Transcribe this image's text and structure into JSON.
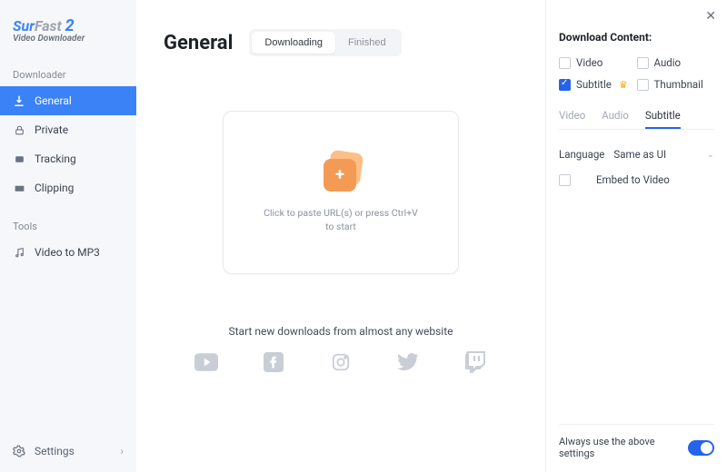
{
  "brand": {
    "part1": "Sur",
    "part2": "Fast",
    "part3": "2",
    "subtitle": "Video Downloader"
  },
  "sidebar": {
    "section1": "Downloader",
    "items1": [
      {
        "label": "General"
      },
      {
        "label": "Private"
      },
      {
        "label": "Tracking"
      },
      {
        "label": "Clipping"
      }
    ],
    "section2": "Tools",
    "items2": [
      {
        "label": "Video to MP3"
      }
    ],
    "settings": "Settings"
  },
  "main": {
    "title": "General",
    "tabs": {
      "downloading": "Downloading",
      "finished": "Finished"
    },
    "drop_hint": "Click to paste URL(s) or press Ctrl+V to start",
    "promo": "Start new downloads from almost any website"
  },
  "panel": {
    "title": "Download Content:",
    "options": {
      "video": "Video",
      "audio": "Audio",
      "subtitle": "Subtitle",
      "thumbnail": "Thumbnail"
    },
    "tabs": {
      "video": "Video",
      "audio": "Audio",
      "subtitle": "Subtitle"
    },
    "language_label": "Language",
    "language_value": "Same as UI",
    "embed": "Embed to Video",
    "footer": "Always use the above settings"
  }
}
